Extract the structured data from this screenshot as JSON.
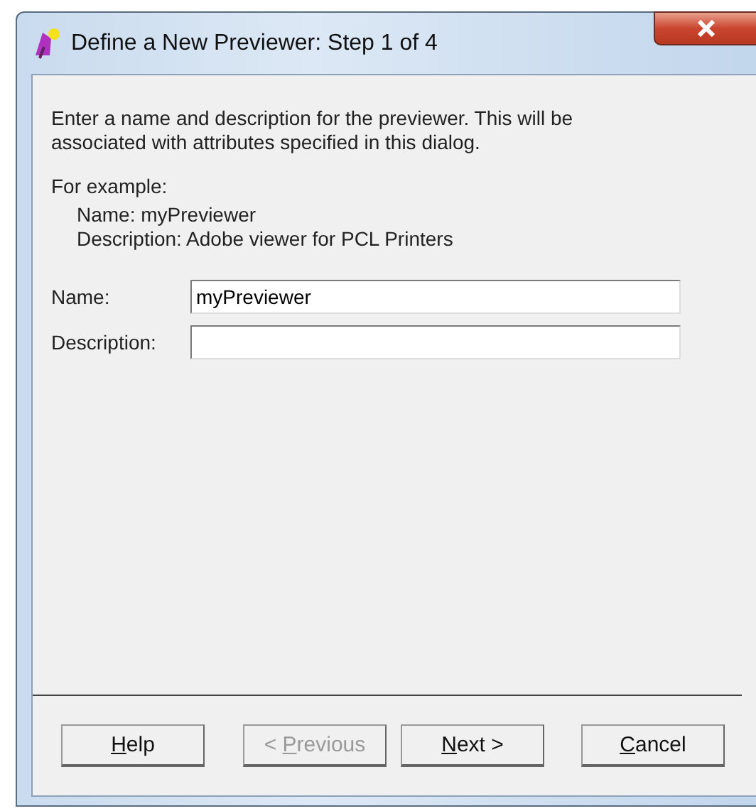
{
  "window": {
    "title": "Define a New Previewer: Step 1 of 4"
  },
  "intro": "Enter a name and description for the previewer.  This will be associated with attributes specified in this dialog.",
  "example_heading": "For example:",
  "example_lines": [
    "Name: myPreviewer",
    "Description: Adobe viewer for PCL Printers"
  ],
  "fields": [
    {
      "label": "Name:",
      "value": "myPreviewer"
    },
    {
      "label": "Description:"
    }
  ],
  "buttons": [
    {
      "key": "H",
      "after": "elp",
      "disabled": false
    },
    {
      "before": "< ",
      "key": "P",
      "after": "revious",
      "disabled": true
    },
    {
      "key": "N",
      "after": "ext >",
      "disabled": false
    },
    {
      "key": "C",
      "after": "ancel",
      "disabled": false
    }
  ]
}
